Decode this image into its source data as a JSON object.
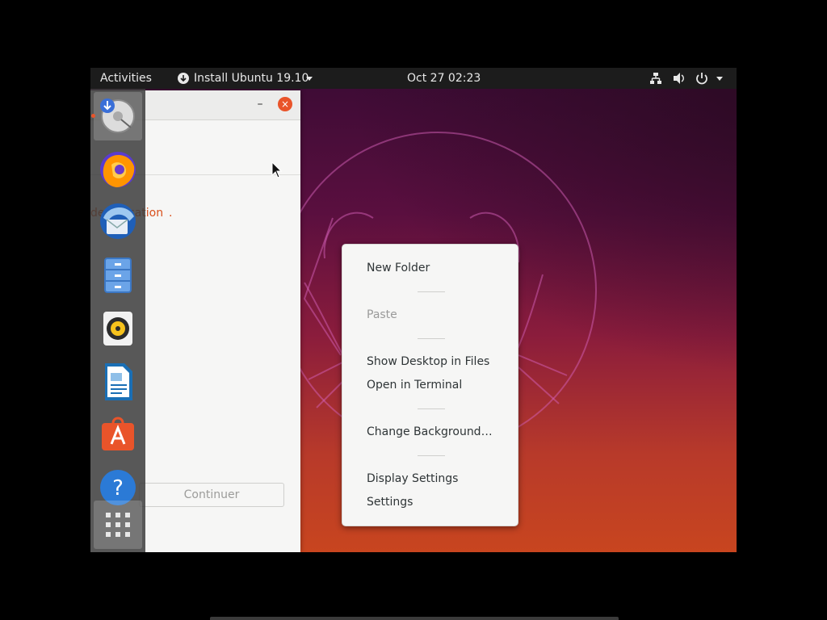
{
  "topbar": {
    "activities_label": "Activities",
    "app_menu_label": "Install Ubuntu 19.10",
    "datetime": "Oct 27  02:23",
    "icons": [
      "download-icon",
      "chevron-down-icon",
      "network-icon",
      "volume-icon",
      "power-icon",
      "chevron-down-icon"
    ]
  },
  "installer": {
    "minimize_label": "–",
    "close_label": "×",
    "link_text": "de",
    "link_text_tail": "cation",
    "link_suffix": ".",
    "continue_label": "Continuer"
  },
  "dock": {
    "items": [
      {
        "name": "ubiquity-installer-icon",
        "running": true,
        "active": true
      },
      {
        "name": "firefox-icon"
      },
      {
        "name": "thunderbird-icon"
      },
      {
        "name": "files-icon"
      },
      {
        "name": "rhythmbox-icon"
      },
      {
        "name": "libreoffice-writer-icon"
      },
      {
        "name": "software-center-icon"
      },
      {
        "name": "help-icon"
      },
      {
        "name": "show-applications-icon"
      }
    ]
  },
  "context_menu": {
    "items": [
      {
        "label": "New Folder",
        "enabled": true
      },
      {
        "label": "Paste",
        "enabled": false
      },
      {
        "label": "Show Desktop in Files",
        "enabled": true
      },
      {
        "label": "Open in Terminal",
        "enabled": true
      },
      {
        "label": "Change Background…",
        "enabled": true
      },
      {
        "label": "Display Settings",
        "enabled": true
      },
      {
        "label": "Settings",
        "enabled": true
      }
    ]
  },
  "colors": {
    "topbar_bg": "#1c1c1c",
    "accent_orange": "#e9542a",
    "wallpaper_top": "#3a0b34",
    "wallpaper_bottom": "#c8451f",
    "menu_bg": "#f6f6f5"
  }
}
